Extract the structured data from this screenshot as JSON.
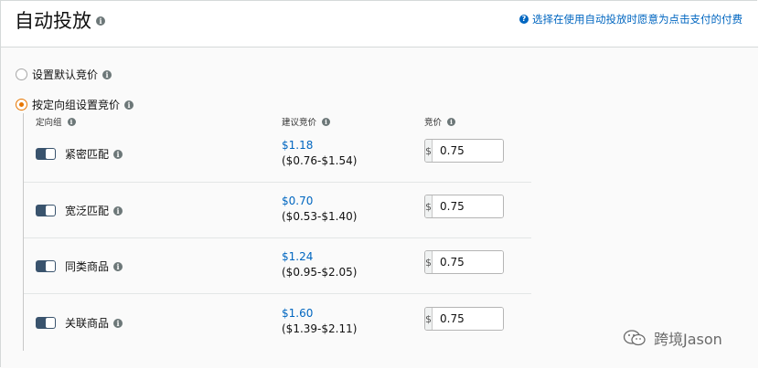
{
  "header": {
    "title": "自动投放",
    "help_link": "选择在使用自动投放时愿意为点击支付的付费"
  },
  "bidding_options": [
    {
      "label": "设置默认竞价",
      "selected": false
    },
    {
      "label": "按定向组设置竞价",
      "selected": true
    }
  ],
  "columns": {
    "group": "定向组",
    "suggested": "建议竞价",
    "bid": "竞价"
  },
  "rows": [
    {
      "name": "紧密匹配",
      "suggested": "$1.18",
      "range": "($0.76-$1.54)",
      "currency": "$",
      "bid": "0.75",
      "enabled": true
    },
    {
      "name": "宽泛匹配",
      "suggested": "$0.70",
      "range": "($0.53-$1.40)",
      "currency": "$",
      "bid": "0.75",
      "enabled": true
    },
    {
      "name": "同类商品",
      "suggested": "$1.24",
      "range": "($0.95-$2.05)",
      "currency": "$",
      "bid": "0.75",
      "enabled": true
    },
    {
      "name": "关联商品",
      "suggested": "$1.60",
      "range": "($1.39-$2.11)",
      "currency": "$",
      "bid": "0.75",
      "enabled": true
    }
  ],
  "watermark": "跨境Jason",
  "colors": {
    "accent_link": "#0066c0",
    "radio_selected": "#e77600",
    "toggle_on": "#39536d"
  }
}
